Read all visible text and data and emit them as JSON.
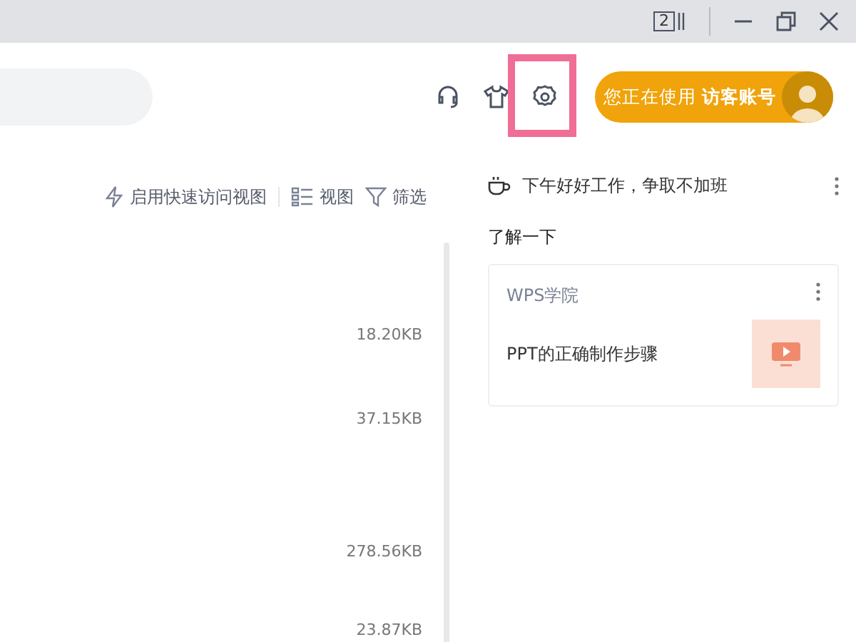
{
  "title_bar": {
    "window_count": "2"
  },
  "header": {
    "tools": [
      {
        "kind": "headset",
        "highlighted": false
      },
      {
        "kind": "shirt",
        "highlighted": false
      },
      {
        "kind": "settings",
        "highlighted": true
      }
    ],
    "account": {
      "prefix": "您正在使用",
      "name": "访客账号"
    }
  },
  "toolbar": [
    {
      "kind": "quick",
      "label": "启用快速访问视图"
    },
    {
      "kind": "view",
      "label": "视图"
    },
    {
      "kind": "filter",
      "label": "筛选"
    }
  ],
  "file_sizes": [
    "18.20KB",
    "37.15KB",
    "278.56KB",
    "23.87KB"
  ],
  "side_panel": {
    "greeting": "下午好好工作，争取不加班",
    "section_title": "了解一下",
    "card": {
      "source": "WPS学院",
      "title": "PPT的正确制作步骤"
    }
  }
}
